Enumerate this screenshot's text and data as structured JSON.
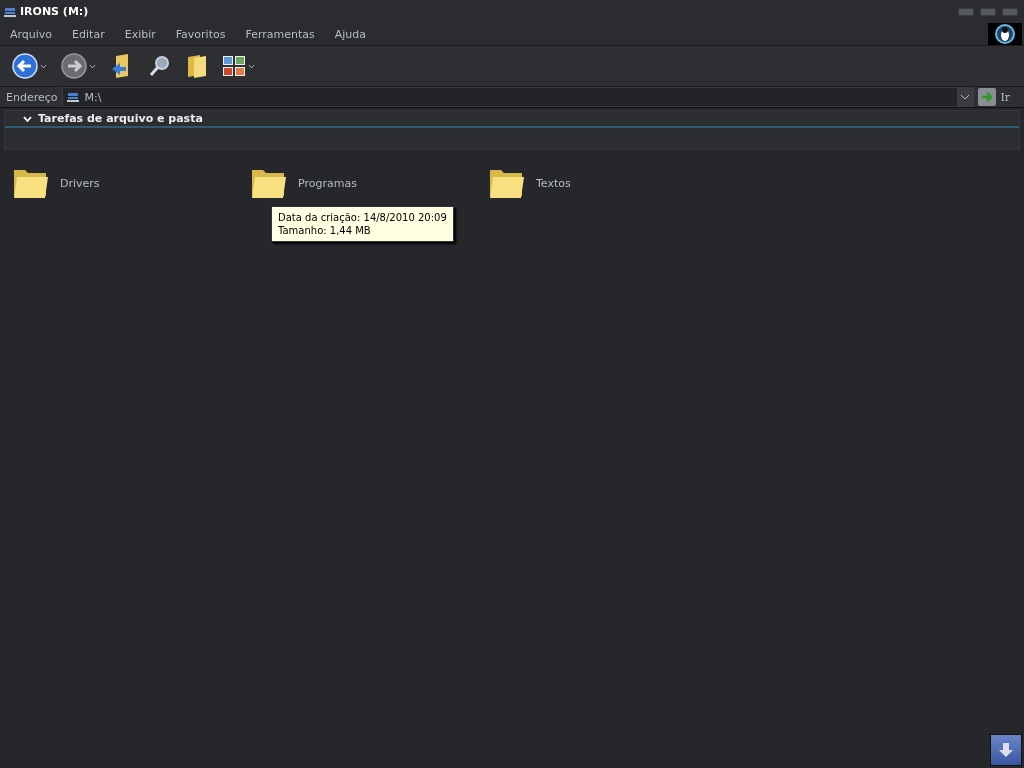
{
  "window": {
    "title": "IRONS (M:)"
  },
  "menu": [
    "Arquivo",
    "Editar",
    "Exibir",
    "Favoritos",
    "Ferramentas",
    "Ajuda"
  ],
  "toolbar": [
    {
      "kind": "back",
      "dropdown": true
    },
    {
      "kind": "forward",
      "dropdown": true
    },
    {
      "kind": "up",
      "dropdown": false
    },
    {
      "kind": "search",
      "dropdown": false
    },
    {
      "kind": "folders",
      "dropdown": false
    },
    {
      "kind": "views",
      "dropdown": true
    }
  ],
  "address": {
    "label": "Endereço",
    "value": "M:\\",
    "go_label": "Ir"
  },
  "task_panel": {
    "title": "Tarefas de arquivo e pasta",
    "expanded": true
  },
  "folders": [
    {
      "name": "Drivers"
    },
    {
      "name": "Programas",
      "tooltip": [
        "Data da criação: 14/8/2010 20:09",
        "Tamanho: 1,44 MB"
      ]
    },
    {
      "name": "Textos"
    }
  ]
}
